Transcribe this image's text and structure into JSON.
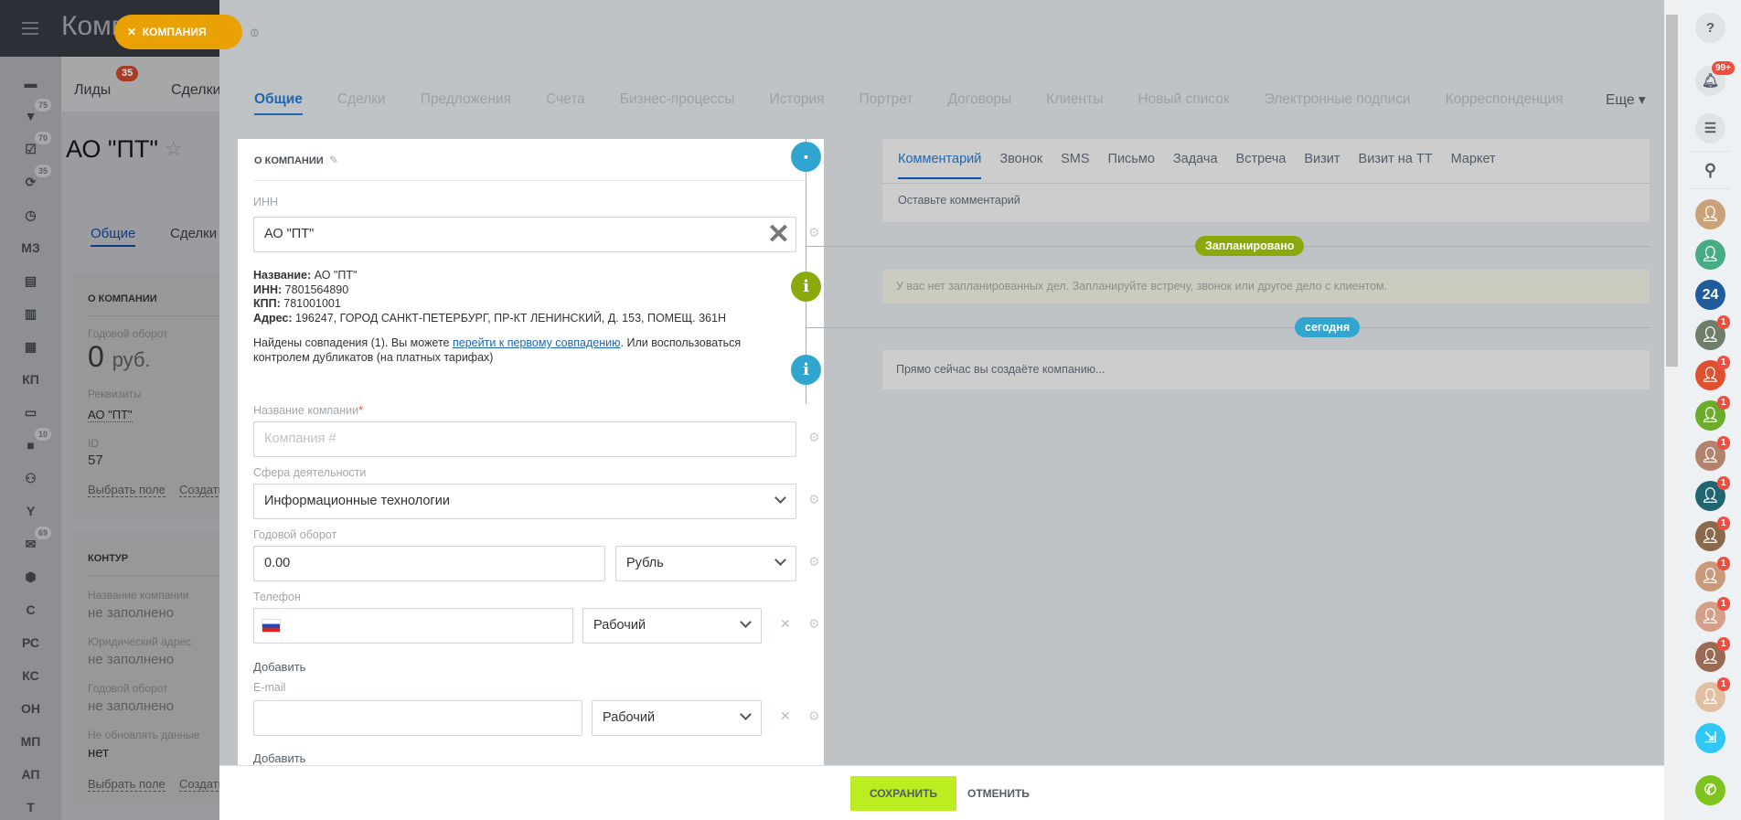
{
  "background_page": {
    "title": "Компании",
    "slider_badge": "КОМПАНИЯ",
    "top_tabs": [
      {
        "label": "Лиды",
        "badge": "35"
      },
      {
        "label": "Сделки",
        "badge": ""
      }
    ],
    "company_name": "АО \"ПТ\"",
    "tabs": [
      "Общие",
      "Сделки"
    ],
    "left_menu": [
      {
        "icon": "window-icon",
        "badge": ""
      },
      {
        "icon": "funnel-icon",
        "badge": "75"
      },
      {
        "icon": "tasks-icon",
        "badge": "70"
      },
      {
        "icon": "sync-icon",
        "badge": "35"
      },
      {
        "icon": "clock-icon",
        "badge": ""
      },
      {
        "label": "МЗ",
        "badge": ""
      },
      {
        "icon": "contact-card-icon",
        "badge": ""
      },
      {
        "icon": "building-icon",
        "badge": ""
      },
      {
        "icon": "calendar-icon",
        "badge": ""
      },
      {
        "label": "КП",
        "badge": ""
      },
      {
        "icon": "drawer-icon",
        "badge": ""
      },
      {
        "icon": "chat-icon",
        "badge": "10"
      },
      {
        "icon": "people-icon",
        "badge": ""
      },
      {
        "icon": "wrench-icon",
        "badge": ""
      },
      {
        "icon": "mail-icon",
        "badge": "69"
      },
      {
        "icon": "box-icon",
        "badge": ""
      },
      {
        "label": "С",
        "badge": ""
      },
      {
        "label": "РС",
        "badge": ""
      },
      {
        "label": "КС",
        "badge": ""
      },
      {
        "label": "ОН",
        "badge": ""
      },
      {
        "label": "МП",
        "badge": ""
      },
      {
        "label": "АП",
        "badge": ""
      },
      {
        "label": "Т",
        "badge": ""
      }
    ],
    "about_card": {
      "title": "О КОМПАНИИ",
      "revenue_label": "Годовой оборот",
      "revenue_value": "0",
      "revenue_currency": "руб.",
      "requisites_label": "Реквизиты",
      "requisites_value": "АО \"ПТ\"",
      "id_label": "ID",
      "id_value": "57",
      "select_field": "Выбрать поле",
      "create_field": "Создать поле"
    },
    "kontur_card": {
      "title": "КОНТУР",
      "fields": [
        {
          "label": "Название компании",
          "value": "не заполнено"
        },
        {
          "label": "Юридический адрес",
          "value": "не заполнено"
        },
        {
          "label": "Годовой оборот",
          "value": "не заполнено"
        },
        {
          "label": "Не обновлять данные",
          "value": "нет"
        }
      ],
      "select_field": "Выбрать поле",
      "create_field": "Создать поле"
    }
  },
  "tabs": [
    "Общие",
    "Сделки",
    "Предложения",
    "Счета",
    "Бизнес-процессы",
    "История",
    "Портрет",
    "Договоры",
    "Клиенты",
    "Новый список",
    "Электронные подписи",
    "Корреспонденция"
  ],
  "more_label": "Еще",
  "form": {
    "section_title": "О КОМПАНИИ",
    "inn_label": "ИНН",
    "inn_value": "АО \"ПТ\"",
    "found": {
      "name_key": "Название:",
      "name_val": " АО \"ПТ\"",
      "inn_key": "ИНН:",
      "inn_val": " 7801564890",
      "kpp_key": "КПП:",
      "kpp_val": " 781001001",
      "addr_key": "Адрес:",
      "addr_val": " 196247, ГОРОД САНКТ-ПЕТЕРБУРГ, ПР-КТ ЛЕНИНСКИЙ, Д. 153, ПОМЕЩ. 361Н"
    },
    "duplicates": {
      "before": "Найдены совпадения (1). Вы можете ",
      "link": "перейти к первому совпадению",
      "after": ". Или воспользоваться контролем дубликатов (на платных тарифах)"
    },
    "company_name_label": "Название компании",
    "company_name_placeholder": "Компания #",
    "industry_label": "Сфера деятельности",
    "industry_value": "Информационные технологии",
    "revenue_label": "Годовой оборот",
    "revenue_value": "0.00",
    "currency_value": "Рубль",
    "phone_label": "Телефон",
    "phone_type": "Рабочий",
    "add_label": "Добавить",
    "email_label": "E-mail",
    "email_type": "Рабочий"
  },
  "timeline": {
    "tabs": [
      "Комментарий",
      "Звонок",
      "SMS",
      "Письмо",
      "Задача",
      "Встреча",
      "Визит",
      "Визит на ТТ",
      "Маркет"
    ],
    "comment_placeholder": "Оставьте комментарий",
    "planned_label": "Запланировано",
    "planned_text": "У вас нет запланированных дел. Запланируйте встречу, звонок или другое дело с клиентом.",
    "today_label": "сегодня",
    "today_text": "Прямо сейчас вы создаёте компанию..."
  },
  "footer": {
    "save": "СОХРАНИТЬ",
    "cancel": "ОТМЕНИТЬ"
  },
  "right_panel": {
    "notifications_badge": "99+",
    "avatars": [
      {
        "color": "#c9a27a",
        "badge": "",
        "text": ""
      },
      {
        "color": "#47ab84",
        "badge": "",
        "text": ""
      },
      {
        "color": "#1f5c9c",
        "badge": "",
        "text": "24"
      },
      {
        "color": "#6f7e68",
        "badge": "1",
        "text": ""
      },
      {
        "color": "#e0502f",
        "badge": "1",
        "text": ""
      },
      {
        "color": "#6bac2a",
        "badge": "1",
        "text": ""
      },
      {
        "color": "#b3826d",
        "badge": "1",
        "text": ""
      },
      {
        "color": "#1f6670",
        "badge": "1",
        "text": ""
      },
      {
        "color": "#8a6a4a",
        "badge": "1",
        "text": ""
      },
      {
        "color": "#c99a7a",
        "badge": "1",
        "text": ""
      },
      {
        "color": "#d4a08a",
        "badge": "1",
        "text": ""
      },
      {
        "color": "#9a6a55",
        "badge": "1",
        "text": ""
      },
      {
        "color": "#e0c0a0",
        "badge": "1",
        "text": ""
      }
    ]
  }
}
